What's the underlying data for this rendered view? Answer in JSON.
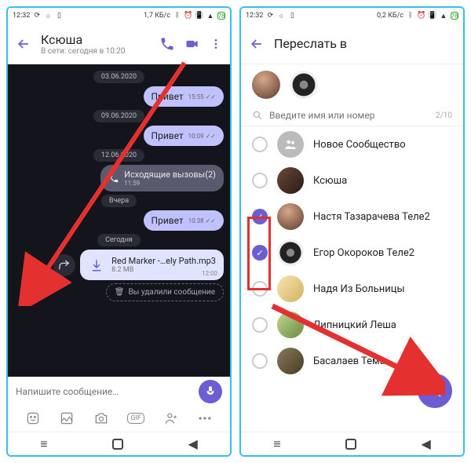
{
  "status": {
    "time": "12:32",
    "data_rate_left": "1,7 КБ/с",
    "data_rate_right": "0,2 КБ/с",
    "battery": "78"
  },
  "left": {
    "header": {
      "title": "Ксюша",
      "subtitle": "В сети: сегодня в 10:20"
    },
    "dates": {
      "d1": "03.06.2020",
      "d2": "09.06.2020",
      "d3": "12.06.2020",
      "d4": "Вчера",
      "d5": "Сегодня"
    },
    "msgs": {
      "m1": {
        "text": "Привет",
        "time": "15:55"
      },
      "m2": {
        "text": "Привет",
        "time": "10:09"
      },
      "call": {
        "text": "Исходящие вызовы(2)",
        "time": "11:59"
      },
      "m3": {
        "text": "Привет",
        "time": "10:38"
      },
      "file": {
        "name": "Red Marker -…ely Path.mp3",
        "size": "8.2 MB",
        "time": "12:00"
      },
      "deleted": "Вы удалили сообщение"
    },
    "composer_placeholder": "Напишите сообщение…"
  },
  "right": {
    "title": "Переслать в",
    "search_placeholder": "Введите имя или номер",
    "counter": "2/10",
    "rows": {
      "r0": "Новое Сообщество",
      "r1": "Ксюша",
      "r2": "Настя Тазарачева Теле2",
      "r3": "Егор Окороков Теле2",
      "r4": "Надя Из Больницы",
      "r5": "Липницкий Леша",
      "r6": "Басалаев Тема"
    }
  }
}
